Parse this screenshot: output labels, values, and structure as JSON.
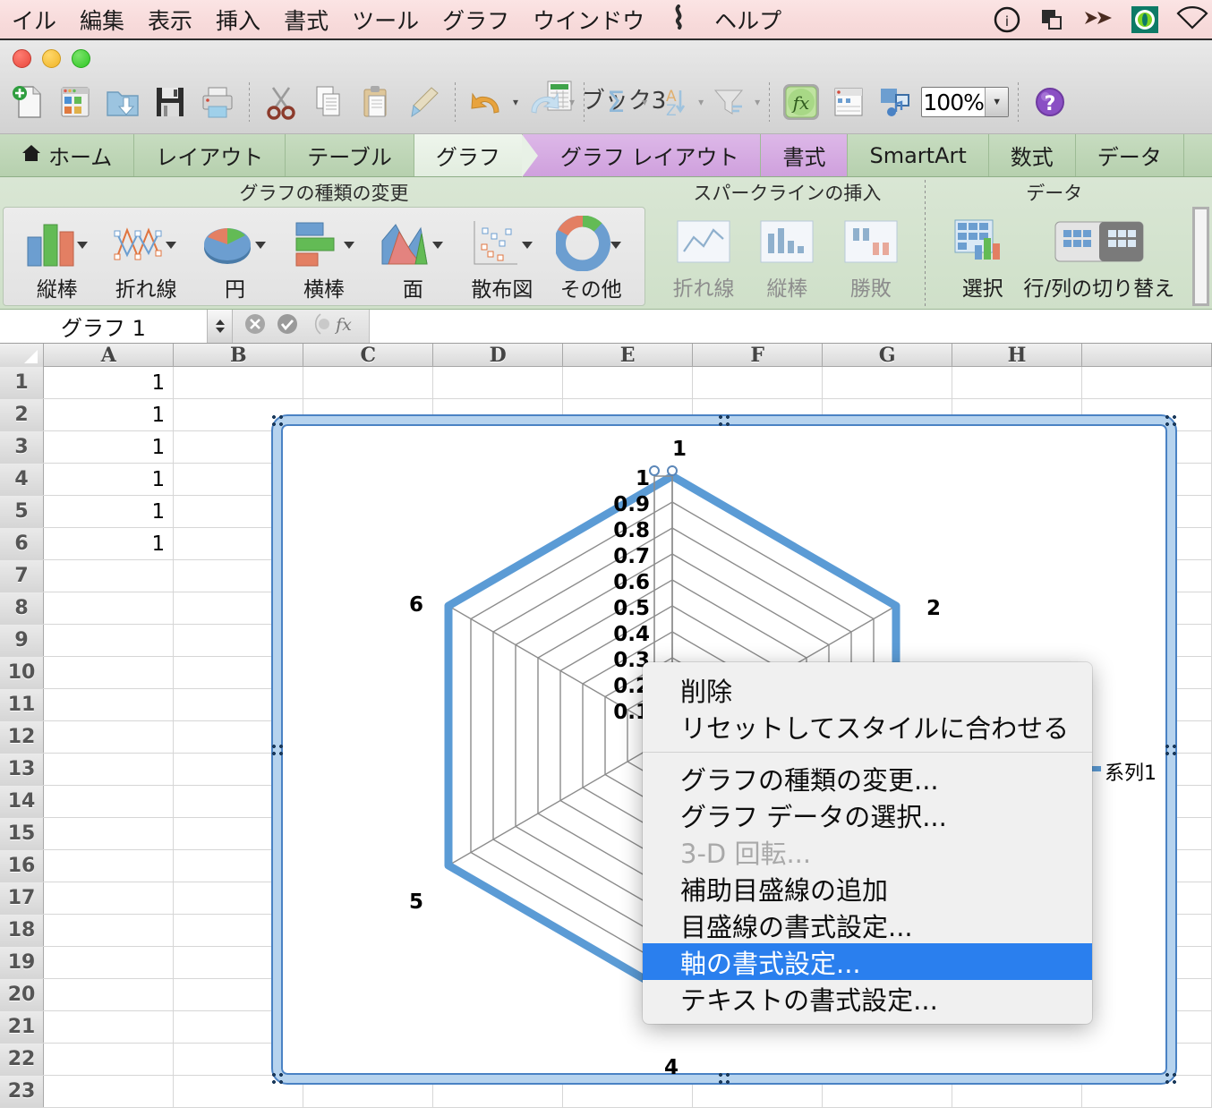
{
  "menubar": {
    "items": [
      "イル",
      "編集",
      "表示",
      "挿入",
      "書式",
      "ツール",
      "グラフ",
      "ウインドウ"
    ],
    "help_label": "ヘルプ",
    "status_icons": [
      "info-circle-icon",
      "duplicate-icon",
      "fast-forward-icon",
      "green-disc-icon",
      "wifi-icon"
    ],
    "bg_color": "#f8dcdc"
  },
  "window": {
    "title": "ブック3",
    "traffic_lights": [
      "close-button",
      "minimize-button",
      "zoom-button"
    ]
  },
  "toolbar": {
    "items": [
      "new-document-icon",
      "open-template-icon",
      "open-folder-icon",
      "save-icon",
      "print-icon",
      "cut-icon",
      "copy-icon",
      "paste-icon",
      "format-painter-icon",
      "undo-icon",
      "redo-icon",
      "autosum-icon",
      "sort-icon",
      "filter-icon",
      "formula-builder-icon",
      "toolbox-icon",
      "media-browser-icon"
    ],
    "zoom_value": "100%",
    "help_icon": "help-icon"
  },
  "ribbon": {
    "tabs": [
      {
        "label": "ホーム",
        "icon": "home-icon",
        "state": "normal"
      },
      {
        "label": "レイアウト",
        "state": "normal"
      },
      {
        "label": "テーブル",
        "state": "normal"
      },
      {
        "label": "グラフ",
        "state": "active"
      },
      {
        "label": "グラフ レイアウト",
        "state": "group"
      },
      {
        "label": "書式",
        "state": "group"
      },
      {
        "label": "SmartArt",
        "state": "normal"
      },
      {
        "label": "数式",
        "state": "normal"
      },
      {
        "label": "データ",
        "state": "normal"
      }
    ],
    "groups": [
      {
        "label": "グラフの種類の変更",
        "items": [
          {
            "label": "縦棒",
            "icon": "column-chart-icon",
            "dropdown": true,
            "dim": false
          },
          {
            "label": "折れ線",
            "icon": "line-chart-icon",
            "dropdown": true,
            "dim": false
          },
          {
            "label": "円",
            "icon": "pie-chart-icon",
            "dropdown": true,
            "dim": false
          },
          {
            "label": "横棒",
            "icon": "bar-chart-icon",
            "dropdown": true,
            "dim": false
          },
          {
            "label": "面",
            "icon": "area-chart-icon",
            "dropdown": true,
            "dim": false
          },
          {
            "label": "散布図",
            "icon": "scatter-chart-icon",
            "dropdown": true,
            "dim": false
          },
          {
            "label": "その他",
            "icon": "other-chart-icon",
            "dropdown": true,
            "dim": false
          }
        ]
      },
      {
        "label": "スパークラインの挿入",
        "items": [
          {
            "label": "折れ線",
            "icon": "sparkline-line-icon",
            "dropdown": false,
            "dim": true
          },
          {
            "label": "縦棒",
            "icon": "sparkline-column-icon",
            "dropdown": false,
            "dim": true
          },
          {
            "label": "勝敗",
            "icon": "sparkline-winloss-icon",
            "dropdown": false,
            "dim": true
          }
        ]
      },
      {
        "label": "データ",
        "items": [
          {
            "label": "選択",
            "icon": "select-data-icon",
            "dropdown": false,
            "dim": false
          },
          {
            "label": "行/列の切り替え",
            "icon": "switch-row-column-icon",
            "dropdown": false,
            "dim": false
          }
        ]
      }
    ]
  },
  "formula_bar": {
    "name_box": "グラフ 1",
    "cancel_icon": "cancel-icon",
    "accept_icon": "accept-icon",
    "function_icon": "fx-icon",
    "formula_value": ""
  },
  "sheet": {
    "columns": [
      "A",
      "B",
      "C",
      "D",
      "E",
      "F",
      "G",
      "H"
    ],
    "rows": [
      {
        "num": "1",
        "a": "1"
      },
      {
        "num": "2",
        "a": "1"
      },
      {
        "num": "3",
        "a": "1"
      },
      {
        "num": "4",
        "a": "1"
      },
      {
        "num": "5",
        "a": "1"
      },
      {
        "num": "6",
        "a": "1"
      },
      {
        "num": "7",
        "a": ""
      },
      {
        "num": "8",
        "a": ""
      },
      {
        "num": "9",
        "a": ""
      },
      {
        "num": "10",
        "a": ""
      },
      {
        "num": "11",
        "a": ""
      },
      {
        "num": "12",
        "a": ""
      },
      {
        "num": "13",
        "a": ""
      },
      {
        "num": "14",
        "a": ""
      },
      {
        "num": "15",
        "a": ""
      },
      {
        "num": "16",
        "a": ""
      },
      {
        "num": "17",
        "a": ""
      },
      {
        "num": "18",
        "a": ""
      },
      {
        "num": "19",
        "a": ""
      },
      {
        "num": "20",
        "a": ""
      },
      {
        "num": "21",
        "a": ""
      },
      {
        "num": "22",
        "a": ""
      },
      {
        "num": "23",
        "a": ""
      }
    ]
  },
  "chart_data": {
    "type": "line",
    "subtype": "radar",
    "title": "",
    "categories": [
      "1",
      "2",
      "3",
      "4",
      "5",
      "6"
    ],
    "series": [
      {
        "name": "系列1",
        "values": [
          1,
          1,
          1,
          1,
          1,
          1
        ],
        "color": "#5b9bd5"
      }
    ],
    "y_tick_labels": [
      "1",
      "0.9",
      "0.8",
      "0.7",
      "0.6",
      "0.5",
      "0.4",
      "0.3",
      "0.2",
      "0.1"
    ],
    "ylim": [
      0,
      1
    ],
    "grid": true,
    "legend_position": "right",
    "legend_entries": [
      "系列1"
    ],
    "selected_element": "value-axis",
    "selection_color": "#4a82c4",
    "gridline_color": "#8c8c8c"
  },
  "context_menu": {
    "items": [
      {
        "label": "削除",
        "state": "normal"
      },
      {
        "label": "リセットしてスタイルに合わせる",
        "state": "normal"
      },
      {
        "label": "__separator__",
        "state": "separator"
      },
      {
        "label": "グラフの種類の変更...",
        "state": "normal"
      },
      {
        "label": "グラフ データの選択...",
        "state": "normal"
      },
      {
        "label": "3-D 回転...",
        "state": "disabled"
      },
      {
        "label": "補助目盛線の追加",
        "state": "normal"
      },
      {
        "label": "目盛線の書式設定...",
        "state": "normal"
      },
      {
        "label": "軸の書式設定...",
        "state": "selected"
      },
      {
        "label": "テキストの書式設定...",
        "state": "normal"
      }
    ],
    "highlight_color": "#2a7fee"
  }
}
